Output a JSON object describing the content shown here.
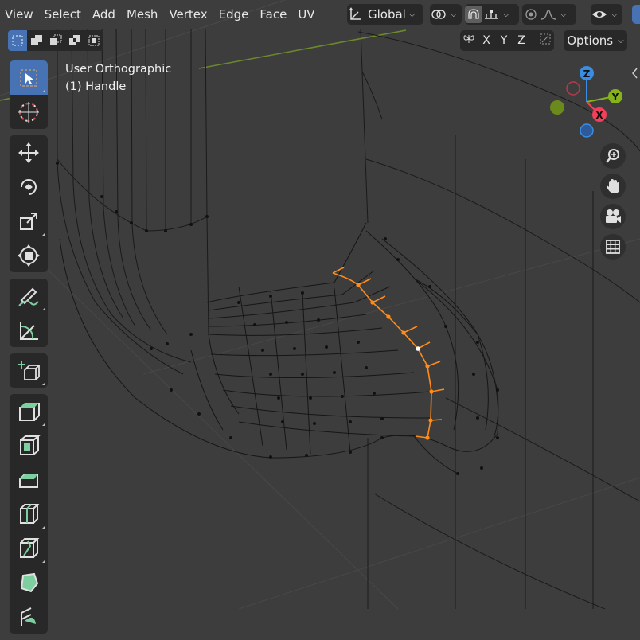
{
  "menu": [
    "View",
    "Select",
    "Add",
    "Mesh",
    "Vertex",
    "Edge",
    "Face",
    "UV"
  ],
  "header": {
    "orientation": "Global",
    "chevron": "⌄"
  },
  "axes": {
    "x": "X",
    "y": "Y",
    "z": "Z"
  },
  "options_label": "Options",
  "viewport": {
    "view_name": "User Orthographic",
    "object_name": "(1) Handle"
  },
  "gizmo": {
    "z": "Z",
    "y": "Y",
    "x": "X"
  },
  "colors": {
    "background": "#3d3d3d",
    "panel": "#282828",
    "accent": "#4772b3",
    "selection": "#ff8c1a",
    "x_axis": "#f2405b",
    "y_axis": "#86b21a",
    "z_axis": "#3a8de2"
  },
  "toolbar_icons": [
    "select-box-icon",
    "cursor-icon",
    "move-icon",
    "rotate-icon",
    "scale-icon",
    "transform-icon",
    "annotate-icon",
    "measure-icon",
    "add-cube-icon",
    "extrude-region-icon",
    "inset-faces-icon",
    "bevel-icon",
    "loop-cut-icon",
    "knife-icon",
    "poly-build-icon",
    "spin-icon"
  ]
}
